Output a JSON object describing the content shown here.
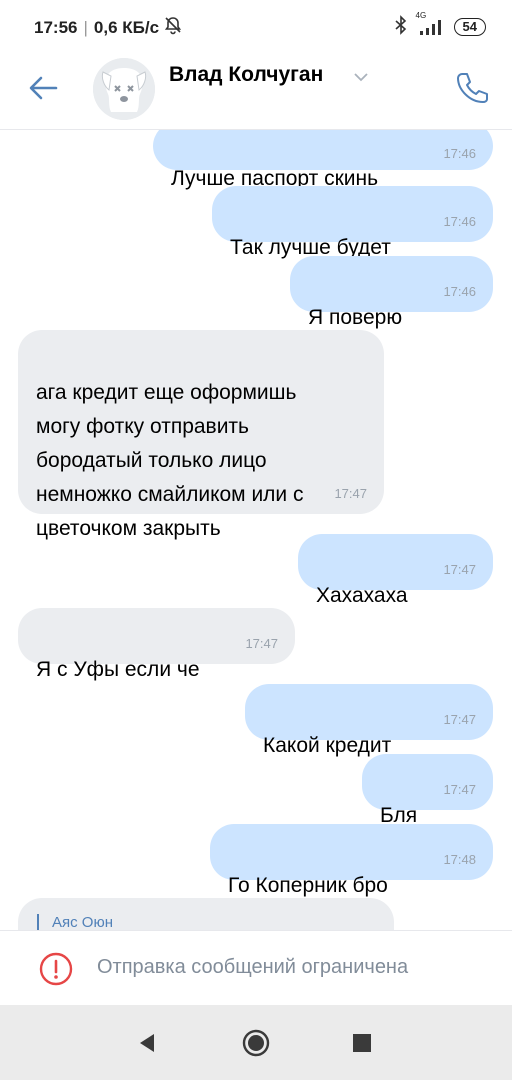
{
  "status_bar": {
    "time": "17:56",
    "separator": "|",
    "network_speed": "0,6 КБ/с",
    "mute_icon": "bell-off-icon",
    "bluetooth_icon": "bluetooth-icon",
    "network_type": "4G",
    "signal_icon": "signal-icon",
    "battery": "54"
  },
  "header": {
    "back_icon": "arrow-left-icon",
    "name": "Влад Колчуган",
    "chevron_icon": "chevron-down-icon",
    "call_icon": "phone-icon"
  },
  "messages": [
    {
      "direction": "out",
      "text": "Лучше паспорт скинь",
      "time": "17:46"
    },
    {
      "direction": "out",
      "text": "Так лучше будет",
      "time": "17:46"
    },
    {
      "direction": "out",
      "text": "Я поверю",
      "time": "17:46"
    },
    {
      "direction": "in",
      "text": "ага кредит еще оформишь\nмогу фотку отправить\nбородатый только лицо\nнемножко смайликом или с\nцветочком закрыть",
      "time": "17:47"
    },
    {
      "direction": "out",
      "text": "Хахахаха",
      "time": "17:47"
    },
    {
      "direction": "in",
      "text": "Я с Уфы если че",
      "time": "17:47"
    },
    {
      "direction": "out",
      "text": "Какой кредит",
      "time": "17:47"
    },
    {
      "direction": "out",
      "text": "Бля",
      "time": "17:47"
    },
    {
      "direction": "out",
      "text": "Го Коперник бро",
      "time": "17:48"
    }
  ],
  "reply_preview": {
    "name": "Аяс Оюн"
  },
  "footer": {
    "warning_icon": "alert-circle-icon",
    "text": "Отправка сообщений ограничена"
  },
  "navbar": {
    "back_icon": "nav-back-icon",
    "home_icon": "nav-home-icon",
    "recents_icon": "nav-recents-icon"
  },
  "colors": {
    "accent": "#5181b8",
    "bubble_out": "#cce4ff",
    "bubble_in": "#ebedf0",
    "warning": "#e64646"
  }
}
